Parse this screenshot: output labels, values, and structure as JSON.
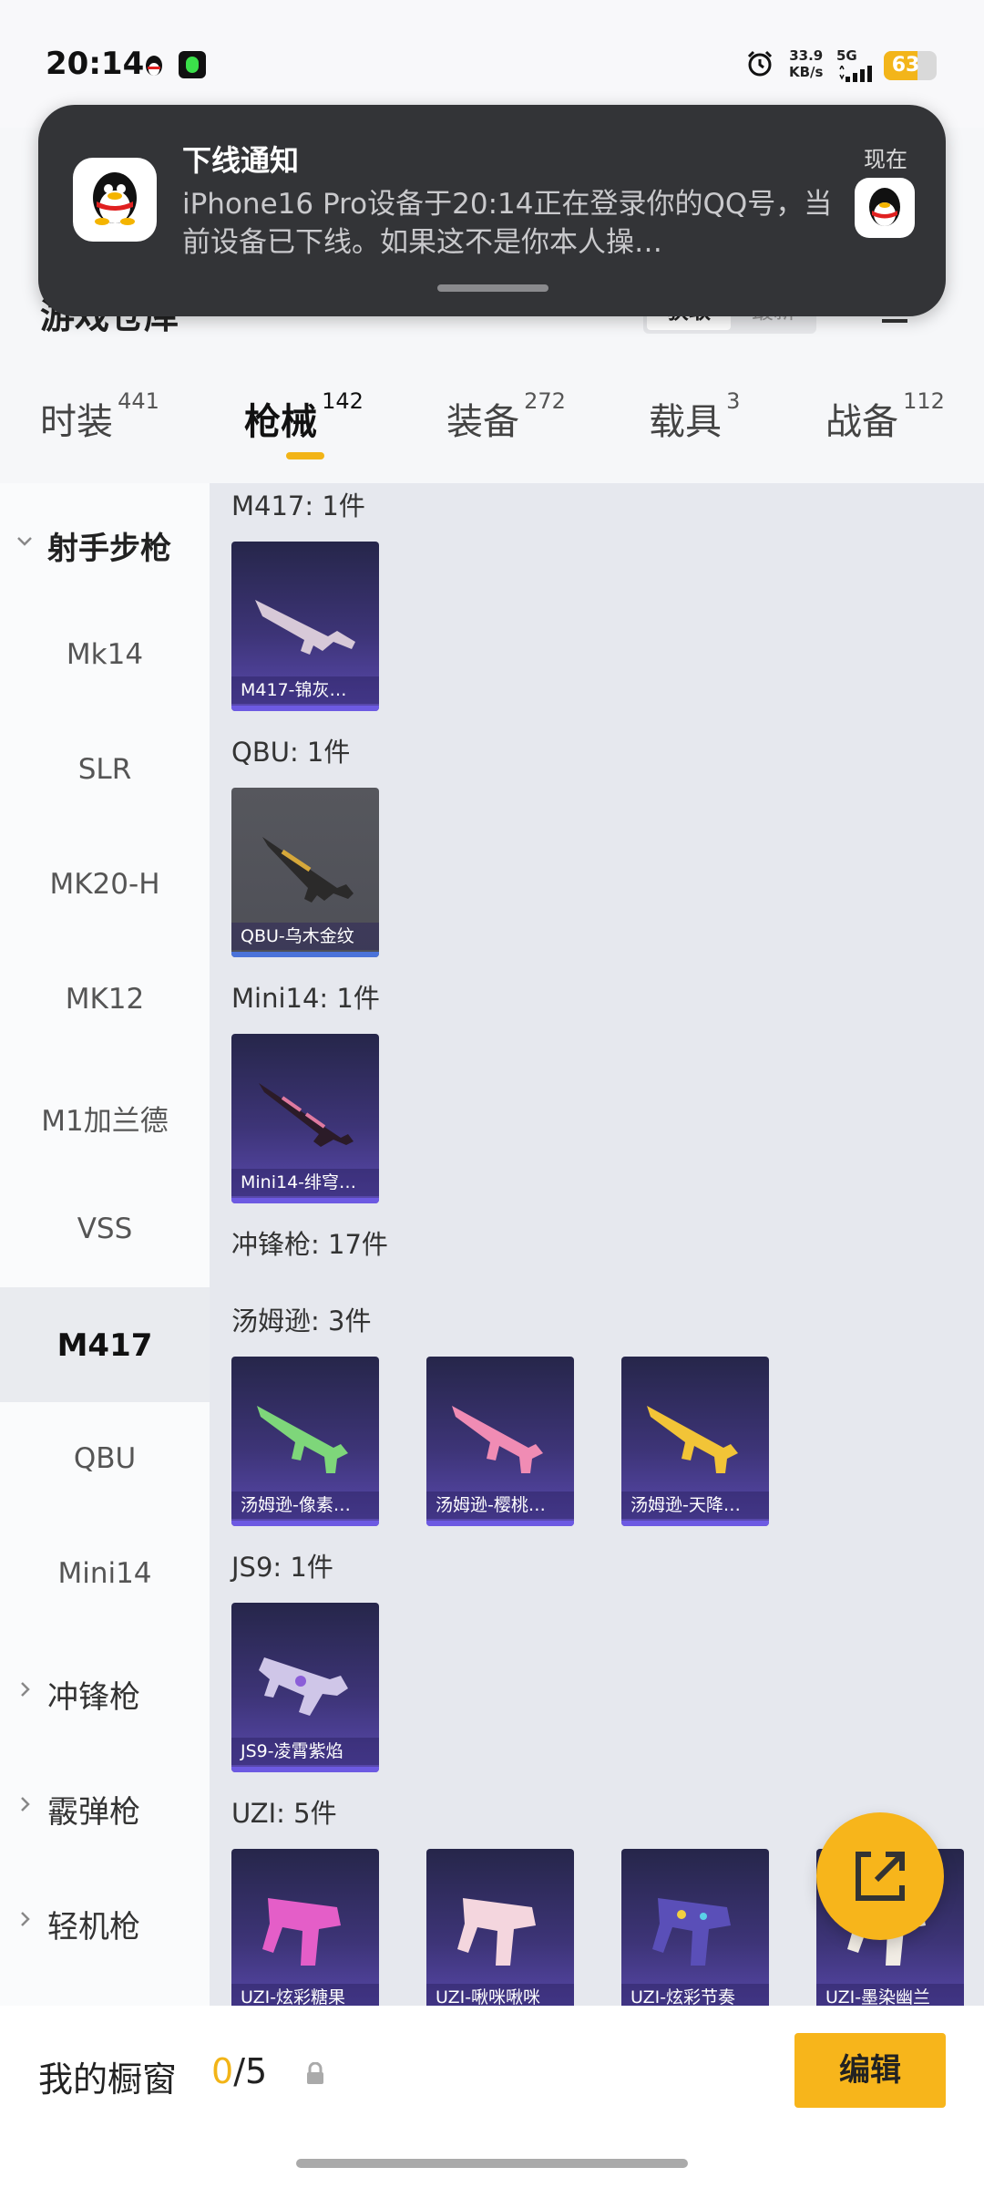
{
  "status_bar": {
    "time": "20:14",
    "net_speed_value": "33.9",
    "net_speed_unit": "KB/s",
    "network": "5G",
    "battery": "63",
    "battery_level": 0.63,
    "battery_color": "#f3b51a"
  },
  "notification": {
    "title": "下线通知",
    "time": "现在",
    "body": "iPhone16 Pro设备于20:14正在登录你的QQ号，当前设备已下线。如果这不是你本人操…"
  },
  "header": {
    "title": "游戏仓库",
    "segment_a": "获取",
    "segment_b": "最新"
  },
  "tabs": [
    {
      "label": "时装",
      "count": "441"
    },
    {
      "label": "枪械",
      "count": "142"
    },
    {
      "label": "装备",
      "count": "272"
    },
    {
      "label": "载具",
      "count": "3"
    },
    {
      "label": "战备",
      "count": "112"
    }
  ],
  "sidebar": [
    {
      "label": "射手步枪"
    },
    {
      "label": "Mk14"
    },
    {
      "label": "SLR"
    },
    {
      "label": "MK20-H"
    },
    {
      "label": "MK12"
    },
    {
      "label": "M1加兰德"
    },
    {
      "label": "VSS"
    },
    {
      "label": "M417"
    },
    {
      "label": "QBU"
    },
    {
      "label": "Mini14"
    },
    {
      "label": "冲锋枪"
    },
    {
      "label": "霰弹枪"
    },
    {
      "label": "轻机枪"
    }
  ],
  "groups": [
    {
      "title": "M417: 1件",
      "items": [
        "M417-锦灰…"
      ]
    },
    {
      "title": "QBU: 1件",
      "items": [
        "QBU-乌木金纹"
      ]
    },
    {
      "title": "Mini14: 1件",
      "items": [
        "Mini14-绯穹…"
      ]
    },
    {
      "title": "冲锋枪: 17件"
    },
    {
      "title": "汤姆逊: 3件",
      "items": [
        "汤姆逊-像素…",
        "汤姆逊-樱桃…",
        "汤姆逊-天降…"
      ]
    },
    {
      "title": "JS9: 1件",
      "items": [
        "JS9-凌霄紫焰"
      ]
    },
    {
      "title": "UZI: 5件",
      "items": [
        "UZI-炫彩糖果",
        "UZI-啾咪啾咪",
        "UZI-炫彩节奏",
        "UZI-墨染幽兰"
      ]
    }
  ],
  "bottom": {
    "label": "我的橱窗",
    "current": "0",
    "total": "/5",
    "edit_label": "编辑"
  },
  "colors": {
    "accent": "#f7b51b",
    "notification_bg": "#333437",
    "card_purple": "#3d3477"
  }
}
